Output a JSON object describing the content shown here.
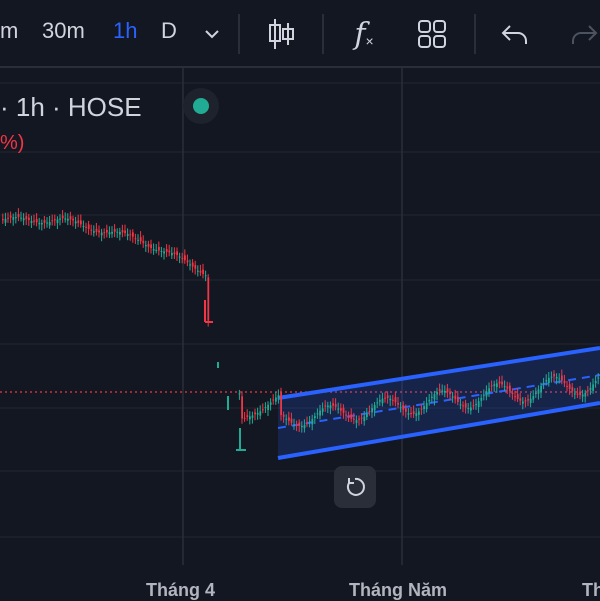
{
  "toolbar": {
    "intervals": [
      "m",
      "30m",
      "1h",
      "D"
    ],
    "active_interval": "1h",
    "icons": [
      "chevron-down-icon",
      "candles-icon",
      "indicators-icon",
      "layout-grid-icon",
      "undo-icon",
      "redo-icon"
    ],
    "indicator_label": "f"
  },
  "legend": {
    "title": "· 1h · HOSE",
    "change": "%)"
  },
  "x_axis": {
    "labels": [
      "Tháng 4",
      "Tháng Năm",
      "Th"
    ]
  },
  "colors": {
    "background": "#131722",
    "up": "#22ab94",
    "down": "#f23645",
    "channel": "#2962ff",
    "price_line": "#f23645"
  },
  "chart_data": {
    "type": "candlestick",
    "xlabel": "",
    "ylabel": "",
    "x_ticks": [
      "Tháng 4",
      "Tháng Năm",
      "Th"
    ],
    "drawings": [
      "parallel-channel"
    ],
    "grid": true
  }
}
